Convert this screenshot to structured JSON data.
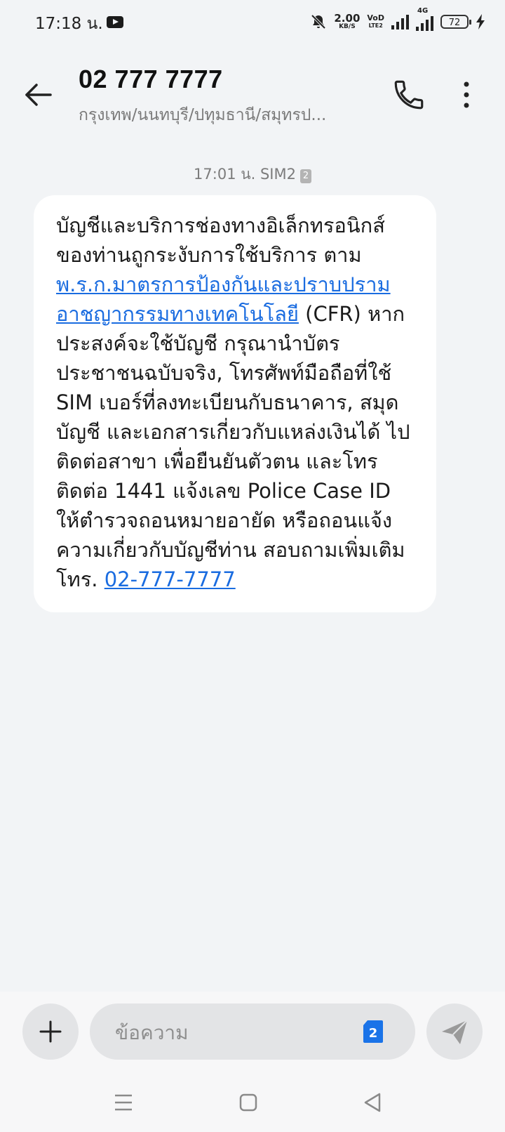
{
  "status_bar": {
    "time": "17:18 น.",
    "net_speed": "2.00",
    "net_unit": "KB/S",
    "volte_top": "VoD",
    "volte_bottom": "LTE2",
    "network": "4G",
    "battery": "72"
  },
  "header": {
    "title": "02 777 7777",
    "subtitle": "กรุงเทพ/นนทบุรี/ปทุมธานี/สมุทรป..."
  },
  "message": {
    "timestamp": "17:01 น. SIM2",
    "sim_badge": "2",
    "text_1": "บัญชีและบริการช่องทางอิเล็กทรอนิกส์ของท่านถูกระงับการใช้บริการ ตาม ",
    "link_law": "พ.ร.ก.มาตรการป้องกันและปราบปรามอาชญากรรมทางเทคโนโลยี",
    "text_2": " (CFR) หากประสงค์จะใช้บัญชี กรุณานำบัตรประชาชนฉบับจริง, โทรศัพท์มือถือที่ใช้ SIM เบอร์ที่ลงทะเบียนกับธนาคาร, สมุดบัญชี และเอกสารเกี่ยวกับแหล่งเงินได้ ไปติดต่อสาขา เพื่อยืนยันตัวตน และโทรติดต่อ 1441 แจ้งเลข Police Case ID ให้ตำรวจถอนหมายอายัด หรือถอนแจ้งความเกี่ยวกับบัญชีท่าน สอบถามเพิ่มเติม โทร. ",
    "link_phone": "02-777-7777"
  },
  "composer": {
    "placeholder": "ข้อความ",
    "sim_number": "2"
  },
  "colors": {
    "background": "#f2f4f6",
    "link": "#1a6ce0",
    "sim_badge": "#1a73e8"
  }
}
